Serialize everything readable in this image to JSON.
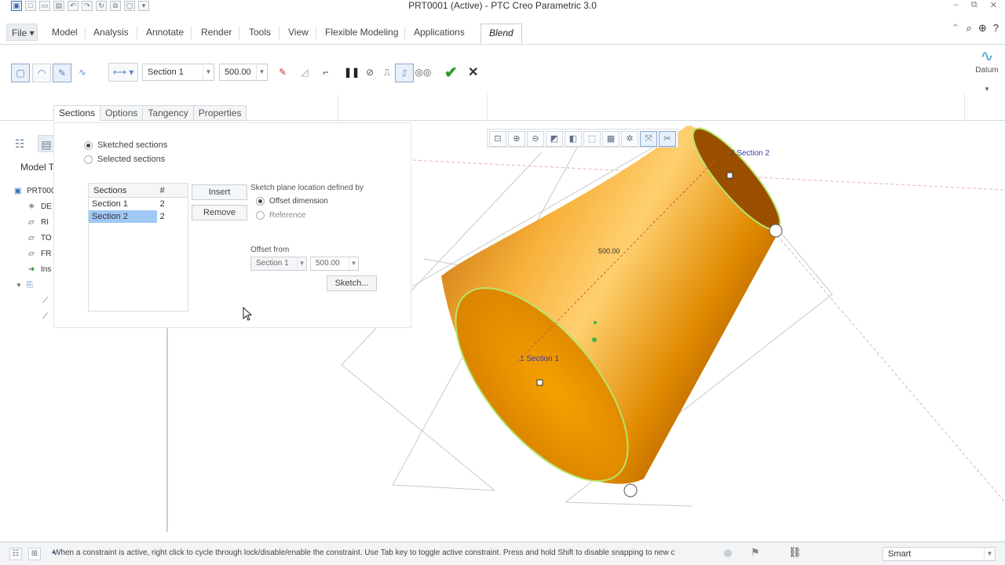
{
  "window": {
    "title": "PRT0001 (Active) - PTC Creo Parametric 3.0"
  },
  "menubar": {
    "tabs": [
      {
        "label": "File ▾"
      },
      {
        "label": "Model"
      },
      {
        "label": "Analysis"
      },
      {
        "label": "Annotate"
      },
      {
        "label": "Render"
      },
      {
        "label": "Tools"
      },
      {
        "label": "View"
      },
      {
        "label": "Flexible Modeling"
      },
      {
        "label": "Applications"
      },
      {
        "label": "Blend"
      }
    ],
    "active_tab": "Blend"
  },
  "ribbon": {
    "section_combo": "Section 1",
    "depth_value": "500.00",
    "datum_label": "Datum"
  },
  "subtabs": [
    {
      "label": "Sections"
    },
    {
      "label": "Options"
    },
    {
      "label": "Tangency"
    },
    {
      "label": "Properties"
    }
  ],
  "sections_panel": {
    "radio_sketched": "Sketched sections",
    "radio_selected": "Selected sections",
    "table_header_sections": "Sections",
    "table_header_count": "#",
    "rows": [
      {
        "name": "Section 1",
        "count": "2"
      },
      {
        "name": "Section 2",
        "count": "2"
      }
    ],
    "insert_label": "Insert",
    "remove_label": "Remove",
    "plane_defined_label": "Sketch plane location defined by",
    "offset_dimension_label": "Offset dimension",
    "reference_label": "Reference",
    "offset_from_label": "Offset from",
    "offset_from_section": "Section 1",
    "offset_from_value": "500.00",
    "sketch_button": "Sketch..."
  },
  "left_panel": {
    "title_truncated": "Model T",
    "items": [
      {
        "label": "PRT000"
      },
      {
        "label": "DE"
      },
      {
        "label": "RI"
      },
      {
        "label": "TO"
      },
      {
        "label": "FR"
      },
      {
        "label": "Ins"
      }
    ]
  },
  "viewport": {
    "section2_label": "2 Section 2",
    "section1_label": "1 Section 1",
    "dimension_label": "500.00"
  },
  "status": {
    "message": "When a constraint is active, right click to cycle through lock/disable/enable the constraint. Use Tab key to toggle active constraint. Press and hold Shift to disable snapping to new c",
    "filter_value": "Smart"
  },
  "colors": {
    "cone_orange": "#e08a00",
    "cone_highlight": "#ffcc55",
    "edge_green": "#b5e56a",
    "accent_blue": "#2f5fa5"
  },
  "icons": {
    "finish": "checkmark-green",
    "cancel": "x-close",
    "pause": "pause-icon"
  }
}
